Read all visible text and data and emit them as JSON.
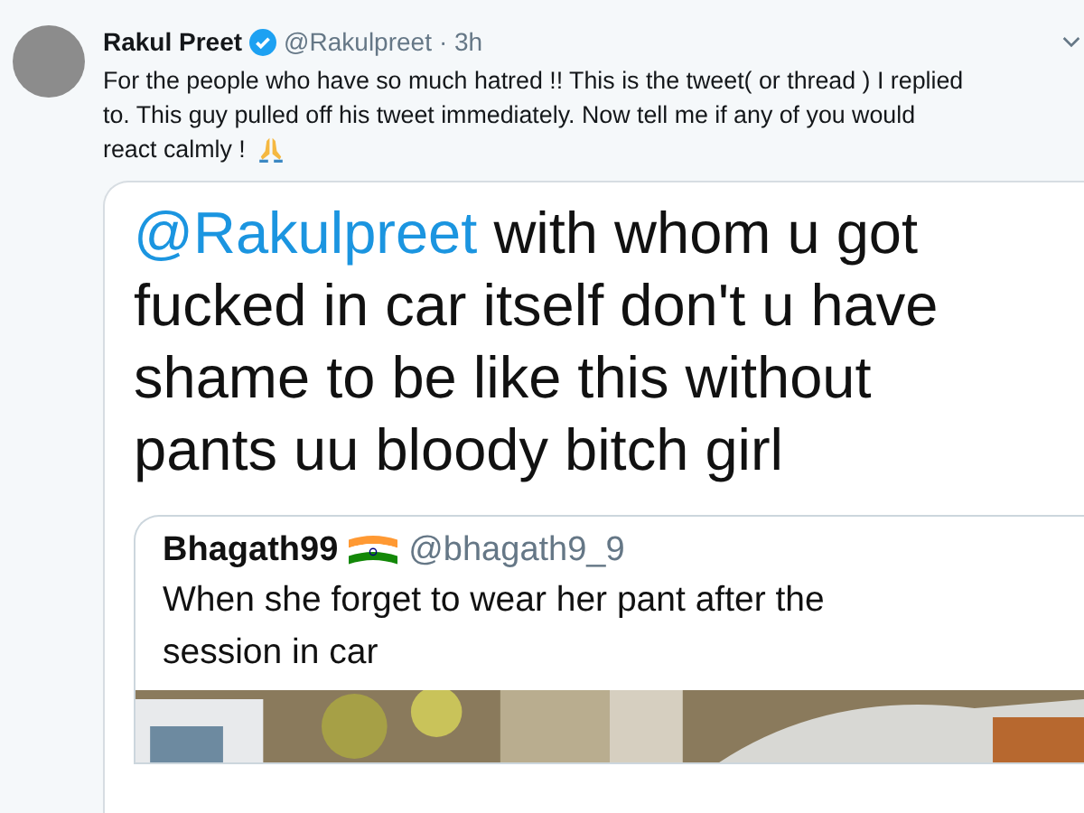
{
  "tweet": {
    "name": "Rakul Preet",
    "verified": true,
    "handle": "@Rakulpreet",
    "time": "· 3h",
    "text_lines": [
      "For the people who have so much hatred !! This is the tweet( or thread ) I replied",
      "to. This guy pulled off his tweet immediately. Now tell me if any of you would",
      "react calmly !"
    ]
  },
  "screenshot": {
    "mention": "@Rakulpreet",
    "lines": [
      "with whom u got",
      "fucked in car itself don't u have",
      "shame to be like this without",
      "pants uu bloody bitch girl"
    ],
    "quoted": {
      "name": "Bhagath99",
      "handle": "@bhagath9_9",
      "text_lines": [
        "When she forget to wear her pant after the",
        "session in car"
      ],
      "media": {
        "kind": "picture"
      }
    }
  }
}
